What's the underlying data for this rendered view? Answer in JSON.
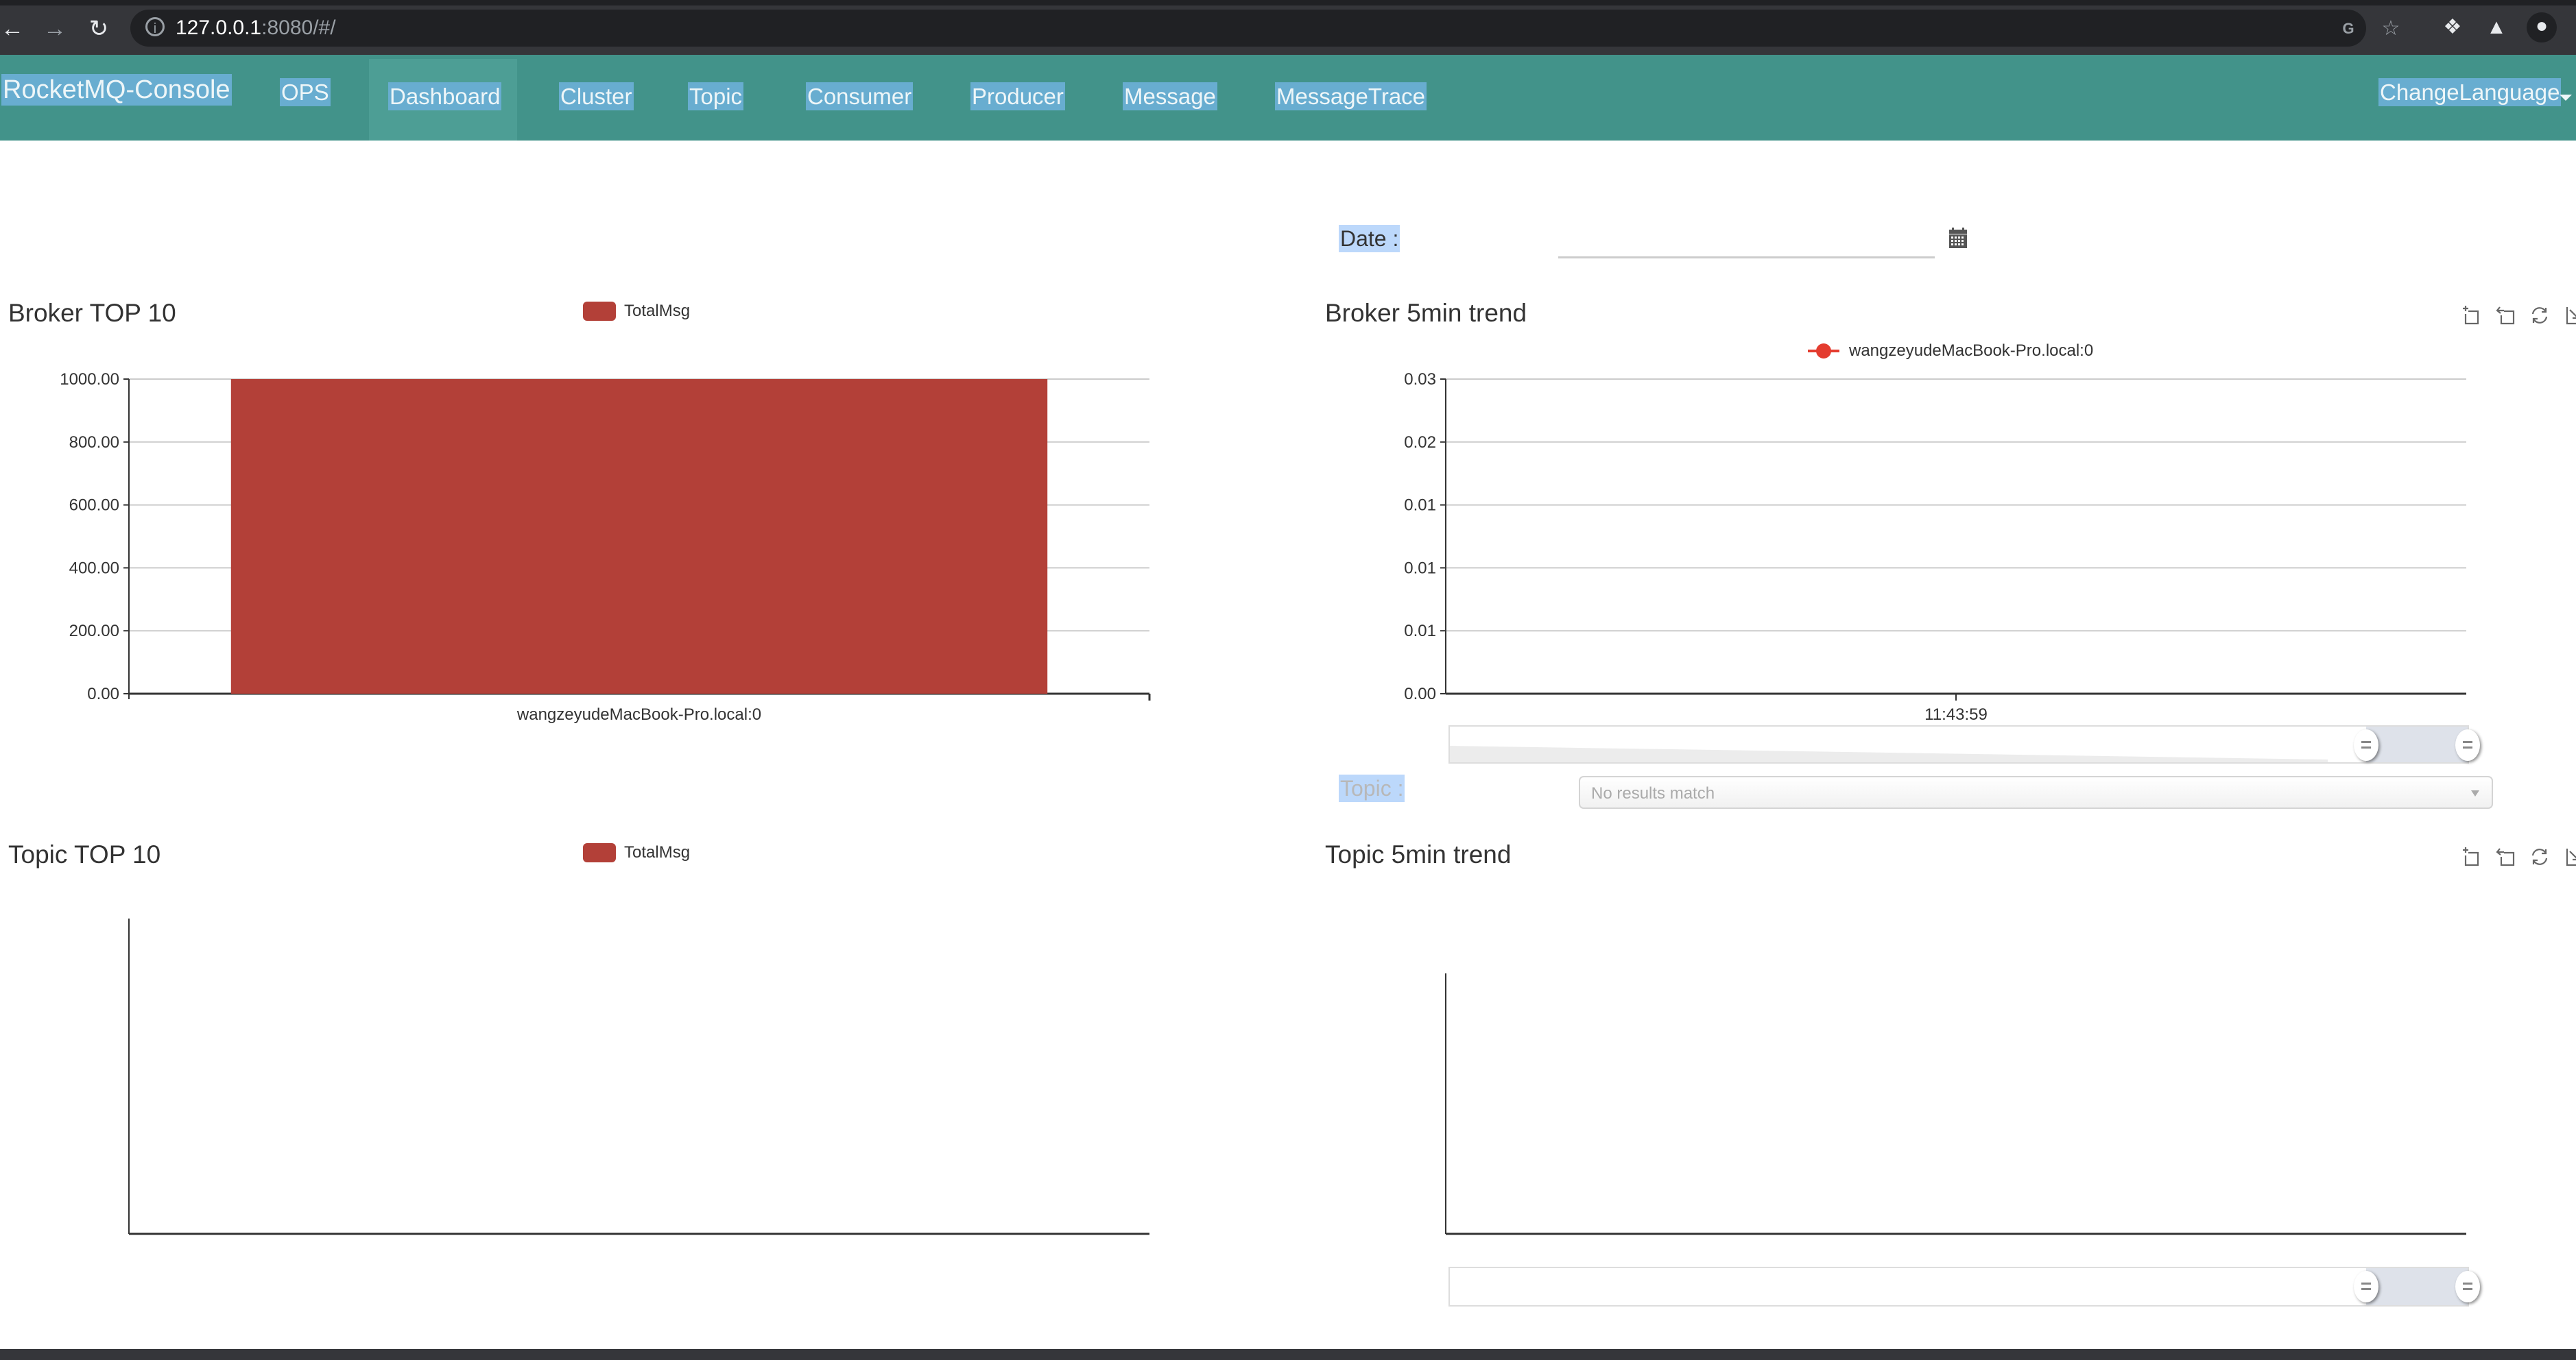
{
  "browser": {
    "url_host": "127.0.0.1",
    "url_rest": ":8080/#/",
    "icons": [
      "back-arrow",
      "forward-arrow",
      "reload",
      "site-info",
      "translate",
      "bookmark-star",
      "extensions-puzzle",
      "labs-flask",
      "profile-avatar"
    ]
  },
  "navbar": {
    "brand": "RocketMQ-Console",
    "items": [
      {
        "label": "OPS",
        "active": false
      },
      {
        "label": "Dashboard",
        "active": true
      },
      {
        "label": "Cluster",
        "active": false
      },
      {
        "label": "Topic",
        "active": false
      },
      {
        "label": "Consumer",
        "active": false
      },
      {
        "label": "Producer",
        "active": false
      },
      {
        "label": "Message",
        "active": false
      },
      {
        "label": "MessageTrace",
        "active": false
      }
    ],
    "language": "ChangeLanguage",
    "colors": {
      "bar": "#42938a",
      "active": "#4d9e95",
      "selection": "#68add0"
    }
  },
  "date_filter": {
    "label": "Date :",
    "value": "",
    "icon": "calendar-icon"
  },
  "topic_filter": {
    "label": "Topic :",
    "placeholder": "No results match"
  },
  "toolbox": [
    "data-zoom",
    "zoom-reset",
    "restore",
    "save-as-image"
  ],
  "chart_data": [
    {
      "id": "broker_top10",
      "type": "bar",
      "title": "Broker TOP 10",
      "legend": [
        "TotalMsg"
      ],
      "legend_position": "top-center",
      "categories": [
        "wangzeyudeMacBook-Pro.local:0"
      ],
      "series": [
        {
          "name": "TotalMsg",
          "values": [
            1000
          ],
          "color": "#b34038"
        }
      ],
      "yticks": [
        "0.00",
        "200.00",
        "400.00",
        "600.00",
        "800.00",
        "1000.00"
      ],
      "ylim": [
        0,
        1000
      ],
      "grid": true,
      "xlabel": "",
      "ylabel": ""
    },
    {
      "id": "broker_5min",
      "type": "line",
      "title": "Broker 5min trend",
      "legend": [
        "wangzeyudeMacBook-Pro.local:0"
      ],
      "legend_position": "top-center",
      "x": [
        "11:43:59"
      ],
      "series": [
        {
          "name": "wangzeyudeMacBook-Pro.local:0",
          "values": [],
          "color": "#e43c2f"
        }
      ],
      "yticks": [
        "0.00",
        "0.01",
        "0.01",
        "0.01",
        "0.02",
        "0.03"
      ],
      "ylim": [
        0,
        0.025
      ],
      "grid": true,
      "datazoom": {
        "start": 0.9,
        "end": 1.0
      },
      "xlabel": "",
      "ylabel": ""
    },
    {
      "id": "topic_top10",
      "type": "bar",
      "title": "Topic TOP 10",
      "legend": [
        "TotalMsg"
      ],
      "legend_position": "top-center",
      "categories": [],
      "series": [
        {
          "name": "TotalMsg",
          "values": [],
          "color": "#b34038"
        }
      ],
      "yticks": [],
      "grid": false,
      "xlabel": "",
      "ylabel": ""
    },
    {
      "id": "topic_5min",
      "type": "line",
      "title": "Topic 5min trend",
      "legend": [],
      "x": [],
      "series": [],
      "yticks": [],
      "grid": false,
      "datazoom": {
        "start": 0.9,
        "end": 1.0
      },
      "xlabel": "",
      "ylabel": ""
    }
  ]
}
